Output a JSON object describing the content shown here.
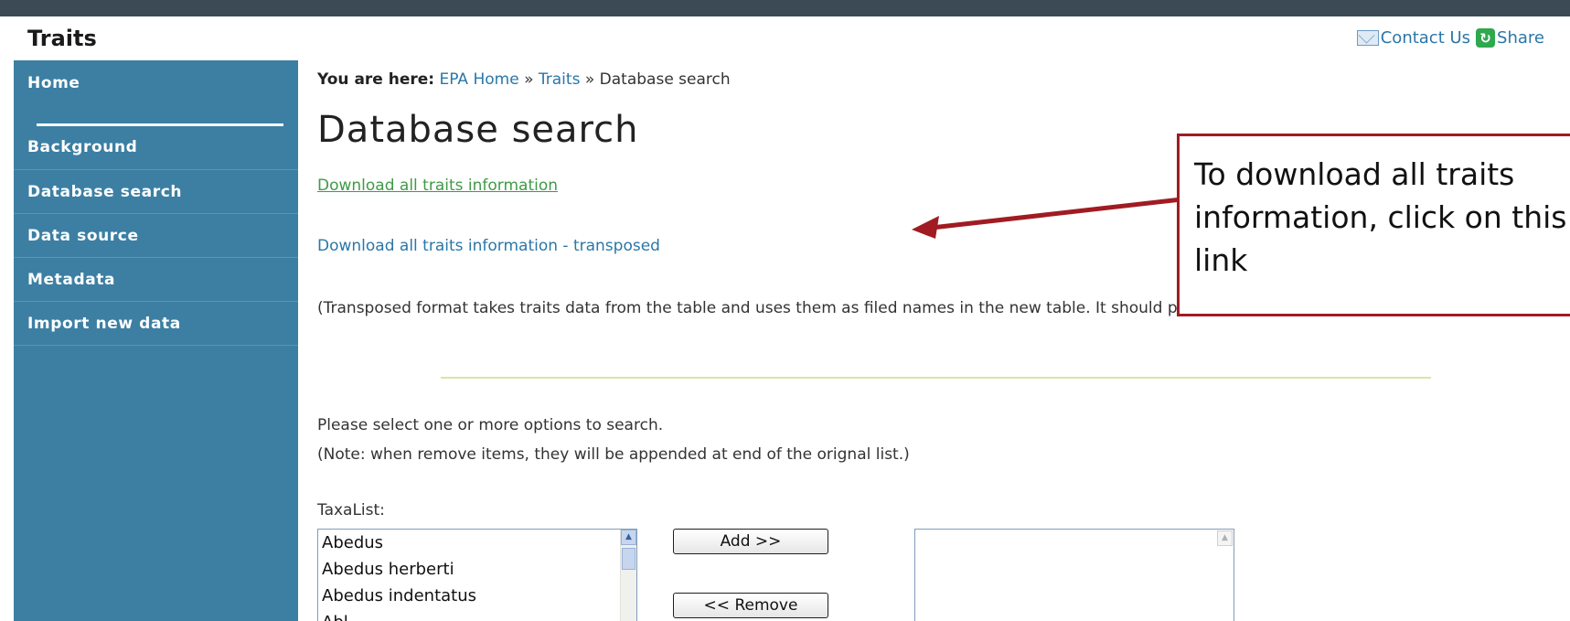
{
  "header": {
    "site_title": "Traits",
    "contact_label": "Contact Us",
    "share_label": "Share",
    "icons": [
      "mail-icon",
      "share-icon"
    ]
  },
  "sidebar": {
    "items": [
      {
        "label": "Home"
      },
      {
        "label": "Background"
      },
      {
        "label": "Database search"
      },
      {
        "label": "Data source"
      },
      {
        "label": "Metadata"
      },
      {
        "label": "Import new data"
      }
    ]
  },
  "breadcrumb": {
    "prefix": "You are here:",
    "home": "EPA Home",
    "sep1": "»",
    "traits": "Traits",
    "sep2": "»",
    "current": "Database search"
  },
  "main": {
    "page_title": "Database search",
    "download_link": "Download all traits information",
    "download_transposed_link": "Download all traits information - transposed",
    "transposed_note": "(Transposed format takes traits data from the table and uses them as filed names in the new table. It should provide more user-friendly interface.)",
    "instruction": "Please select one or more options to search.",
    "instruction_note": "(Note: when remove items, they will be appended at end of the orignal list.)",
    "taxa_label": "TaxaList:",
    "taxa_options": [
      "Abedus",
      "Abedus herberti",
      "Abedus indentatus",
      "Abl..."
    ],
    "add_button": "Add >>",
    "remove_button": "<< Remove"
  },
  "annotation": {
    "text": "To download all traits information, click on this link",
    "color": "#a01c22"
  },
  "colors": {
    "sidebar_bg": "#3c7fa3",
    "link_blue": "#2a77a8",
    "link_green": "#3f9b45",
    "topbar": "#3b4a54"
  }
}
